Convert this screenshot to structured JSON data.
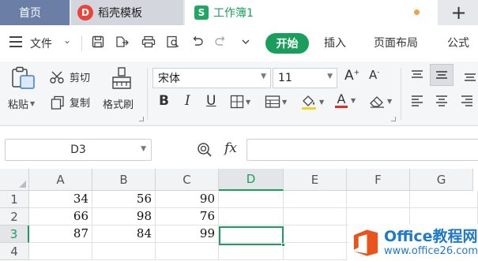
{
  "tabs": {
    "home": "首页",
    "daoke": "稻壳模板",
    "workbook": "工作簿1",
    "add_symbol": "+"
  },
  "menu": {
    "file": "文件",
    "ribbon_tabs": [
      "开始",
      "插入",
      "页面布局",
      "公式"
    ]
  },
  "ribbon": {
    "paste": "粘贴",
    "cut": "剪切",
    "copy": "复制",
    "format_painter": "格式刷",
    "font_name": "宋体",
    "font_size": "11"
  },
  "formula_bar": {
    "name_box": "D3",
    "fx": "fx",
    "formula": ""
  },
  "sheet": {
    "columns": [
      "A",
      "B",
      "C",
      "D",
      "E",
      "F",
      "G"
    ],
    "rows": [
      "1",
      "2",
      "3",
      "4"
    ],
    "cells": [
      [
        "34",
        "56",
        "90"
      ],
      [
        "66",
        "98",
        "76"
      ],
      [
        "87",
        "84",
        "99"
      ]
    ],
    "active_column": "D",
    "active_row": "3"
  },
  "watermark": {
    "brand": "Office教程网",
    "url": "www.office26.com"
  },
  "colors": {
    "accent": "#1b9e5c",
    "home_tab": "#6b7ea6"
  }
}
